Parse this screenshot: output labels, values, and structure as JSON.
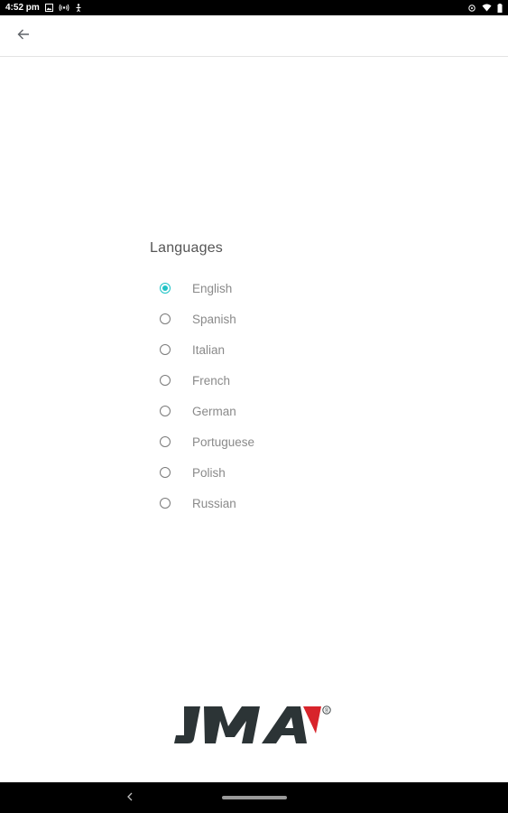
{
  "status_bar": {
    "time": "4:52 pm",
    "icons": [
      "gallery-icon",
      "broadcast-icon",
      "accessibility-icon",
      "rotate-icon",
      "wifi-icon",
      "battery-icon"
    ]
  },
  "app_bar": {
    "back_icon": "arrow-left-icon"
  },
  "languages": {
    "title": "Languages",
    "selected": "English",
    "items": [
      {
        "label": "English",
        "checked": true
      },
      {
        "label": "Spanish",
        "checked": false
      },
      {
        "label": "Italian",
        "checked": false
      },
      {
        "label": "French",
        "checked": false
      },
      {
        "label": "German",
        "checked": false
      },
      {
        "label": "Portuguese",
        "checked": false
      },
      {
        "label": "Polish",
        "checked": false
      },
      {
        "label": "Russian",
        "checked": false
      }
    ]
  },
  "logo": {
    "text": "JMA",
    "registered": "®"
  },
  "colors": {
    "accent": "#1ec3c6",
    "logo_dark": "#2c3436",
    "logo_red": "#d8242b"
  },
  "nav_bar": {
    "back_icon": "nav-back-icon",
    "home_icon": "home-pill-icon"
  }
}
